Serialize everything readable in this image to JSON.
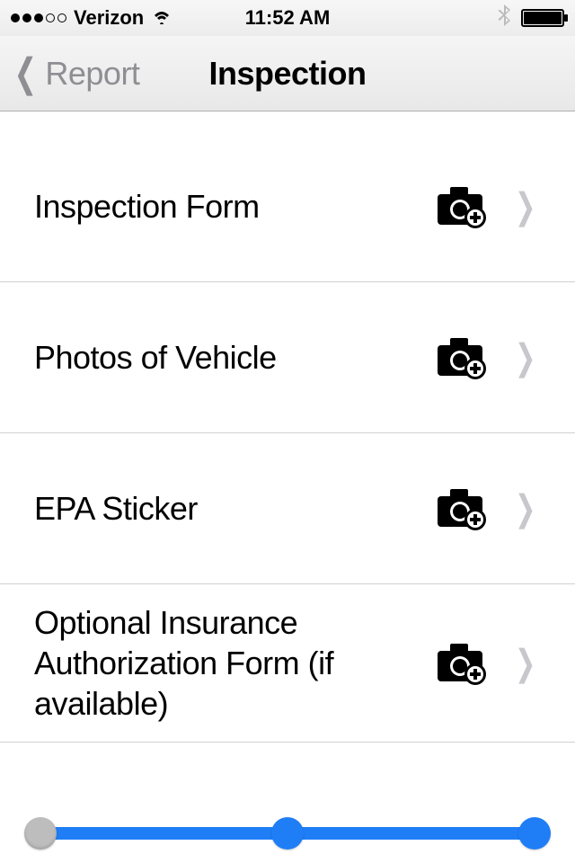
{
  "status": {
    "carrier": "Verizon",
    "time": "11:52 AM"
  },
  "nav": {
    "back_label": "Report",
    "title": "Inspection"
  },
  "rows": {
    "r0": "Inspection Form",
    "r1": "Photos of Vehicle",
    "r2": "EPA Sticker",
    "r3": "Optional Insurance Authorization Form (if available)"
  }
}
